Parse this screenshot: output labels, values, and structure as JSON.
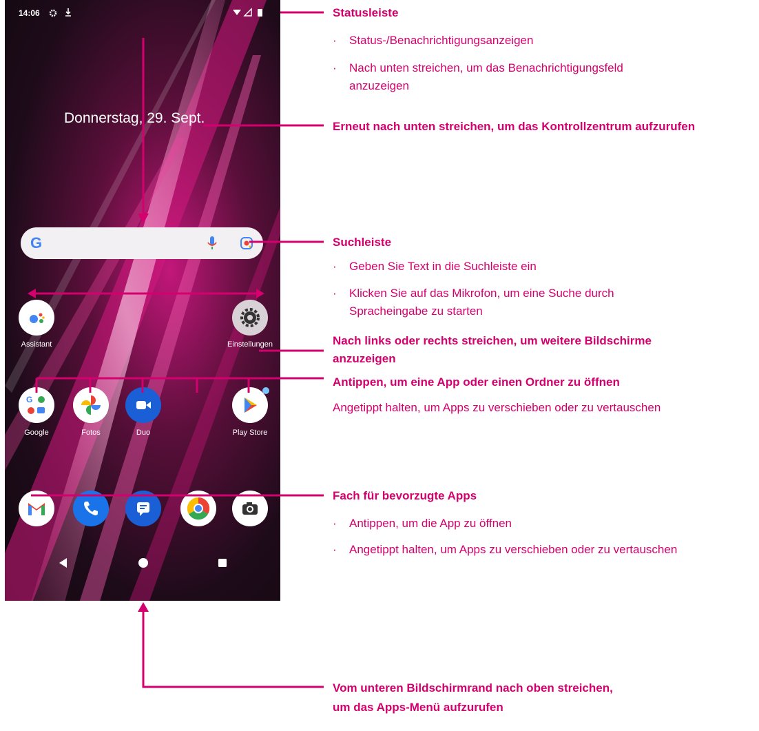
{
  "status_bar": {
    "time": "14:06"
  },
  "home": {
    "date": "Donnerstag, 29. Sept.",
    "search_g": "G",
    "row1": [
      {
        "label": "Assistant",
        "icon": "assistant-icon"
      },
      {
        "label": "Einstellungen",
        "icon": "settings-gear-icon"
      }
    ],
    "row2": [
      {
        "label": "Google",
        "icon": "google-folder-icon"
      },
      {
        "label": "Fotos",
        "icon": "photos-icon"
      },
      {
        "label": "Duo",
        "icon": "duo-video-icon"
      },
      {
        "label": "Play Store",
        "icon": "play-store-icon"
      }
    ],
    "dock": [
      {
        "icon": "gmail-icon"
      },
      {
        "icon": "phone-icon"
      },
      {
        "icon": "messages-icon"
      },
      {
        "icon": "chrome-icon"
      },
      {
        "icon": "camera-icon"
      }
    ]
  },
  "annotations": {
    "statusbar_title": "Statusleiste",
    "statusbar_b1": "Status-/Benachrichtigungsanzeigen",
    "statusbar_b2a": "Nach unten streichen, um das Benachrichtigungsfeld",
    "statusbar_b2b": "anzuzeigen",
    "control_center": "Erneut nach unten streichen, um das Kontrollzentrum aufzurufen",
    "search_title": "Suchleiste",
    "search_b1": "Geben Sie Text in die Suchleiste ein",
    "search_b2a": "Klicken Sie auf das Mikrofon, um eine Suche durch",
    "search_b2b": "Spracheingabe zu starten",
    "swipe_a": "Nach links oder rechts streichen, um weitere Bildschirme",
    "swipe_b": "anzuzeigen",
    "tap_open": "Antippen, um eine App oder einen Ordner zu öffnen",
    "hold_move": "Angetippt halten, um Apps zu verschieben oder zu vertauschen",
    "fav_title": "Fach für bevorzugte Apps",
    "fav_b1": "Antippen, um die App zu öffnen",
    "fav_b2": "Angetippt halten, um Apps zu verschieben oder zu vertauschen",
    "apps_a": "Vom unteren Bildschirmrand nach oben streichen,",
    "apps_b": "um das Apps-Menü aufzurufen"
  },
  "colors": {
    "accent": "#d4006e"
  }
}
